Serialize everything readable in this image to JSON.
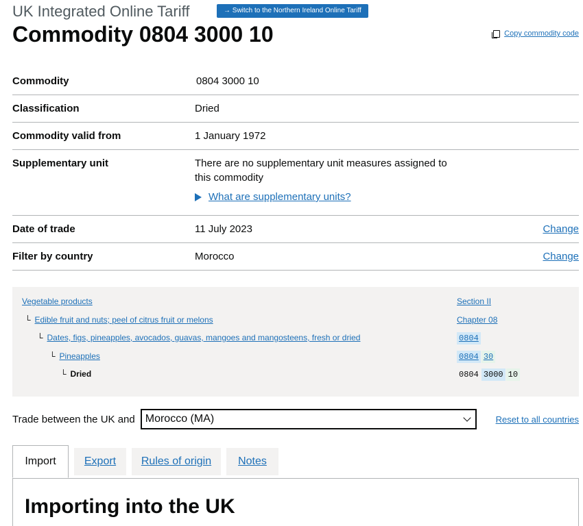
{
  "header": {
    "service_name": "UK Integrated Online Tariff",
    "switch_label": "→ Switch to the Northern Ireland Online Tariff",
    "title": "Commodity 0804 3000 10",
    "copy_label": "Copy commodity code",
    "copy_icon": "copy-icon"
  },
  "summary": {
    "commodity": {
      "key": "Commodity",
      "value": "0804 3000 10"
    },
    "classification": {
      "key": "Classification",
      "value": "Dried"
    },
    "valid_from": {
      "key": "Commodity valid from",
      "value": "1 January 1972"
    },
    "supplementary": {
      "key": "Supplementary unit",
      "value": "There are no supplementary unit measures assigned to this commodity",
      "details_label": "What are supplementary units?"
    },
    "date_of_trade": {
      "key": "Date of trade",
      "value": "11 July 2023",
      "action": "Change"
    },
    "filter_country": {
      "key": "Filter by country",
      "value": "Morocco",
      "action": "Change"
    }
  },
  "breadcrumbs": {
    "elbow": "└",
    "items": [
      {
        "label": "Vegetable products",
        "code": "Section II"
      },
      {
        "label": "Edible fruit and nuts; peel of citrus fruit or melons",
        "code": "Chapter 08"
      },
      {
        "label": "Dates, figs, pineapples, avocados, guavas, mangoes and mangosteens, fresh or dried",
        "code": "0804"
      },
      {
        "label": "Pineapples",
        "code_parts": [
          "0804",
          "30"
        ]
      },
      {
        "label": "Dried",
        "code_parts": [
          "0804",
          "3000",
          "10"
        ]
      }
    ]
  },
  "trade": {
    "label": "Trade between the UK and",
    "selected": "Morocco (MA)",
    "reset": "Reset to all countries"
  },
  "tabs": [
    "Import",
    "Export",
    "Rules of origin",
    "Notes"
  ],
  "panel": {
    "heading": "Importing into the UK"
  },
  "colors": {
    "link": "#1d70b8",
    "text": "#0b0c0c",
    "border": "#b1b4b6",
    "panel_bg": "#f3f2f1"
  }
}
